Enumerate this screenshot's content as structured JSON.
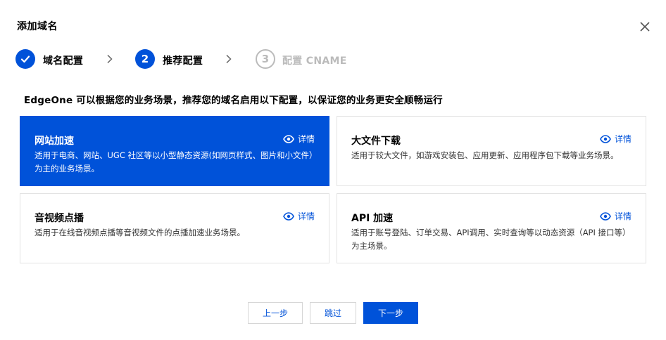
{
  "dialog": {
    "title": "添加域名"
  },
  "steps": [
    {
      "number": "1",
      "label": "域名配置",
      "state": "done"
    },
    {
      "number": "2",
      "label": "推荐配置",
      "state": "active"
    },
    {
      "number": "3",
      "label": "配置 CNAME",
      "state": "pending"
    }
  ],
  "intro": "EdgeOne 可以根据您的业务场景，推荐您的域名启用以下配置，以保证您的业务更安全顺畅运行",
  "cards": [
    {
      "title": "网站加速",
      "detail": "详情",
      "desc": "适用于电商、网站、UGC 社区等以小型静态资源(如网页样式、图片和小文件）为主的业务场景。",
      "selected": true
    },
    {
      "title": "大文件下载",
      "detail": "详情",
      "desc": "适用于较大文件，如游戏安装包、应用更新、应用程序包下载等业务场景。",
      "selected": false
    },
    {
      "title": "音视频点播",
      "detail": "详情",
      "desc": "适用于在线音视频点播等音视频文件的点播加速业务场景。",
      "selected": false
    },
    {
      "title": "API 加速",
      "detail": "详情",
      "desc": "适用于账号登陆、订单交易、API调用、实时查询等以动态资源（API 接口等）为主场景。",
      "selected": false
    }
  ],
  "buttons": {
    "prev": "上一步",
    "skip": "跳过",
    "next": "下一步"
  },
  "colors": {
    "primary": "#0052d9",
    "disabled": "#bbbbbb",
    "border": "#e3e3e3"
  },
  "icons": {
    "close": "close-icon",
    "check": "check-icon",
    "chevron": "chevron-right-icon",
    "detail": "eye-icon"
  }
}
